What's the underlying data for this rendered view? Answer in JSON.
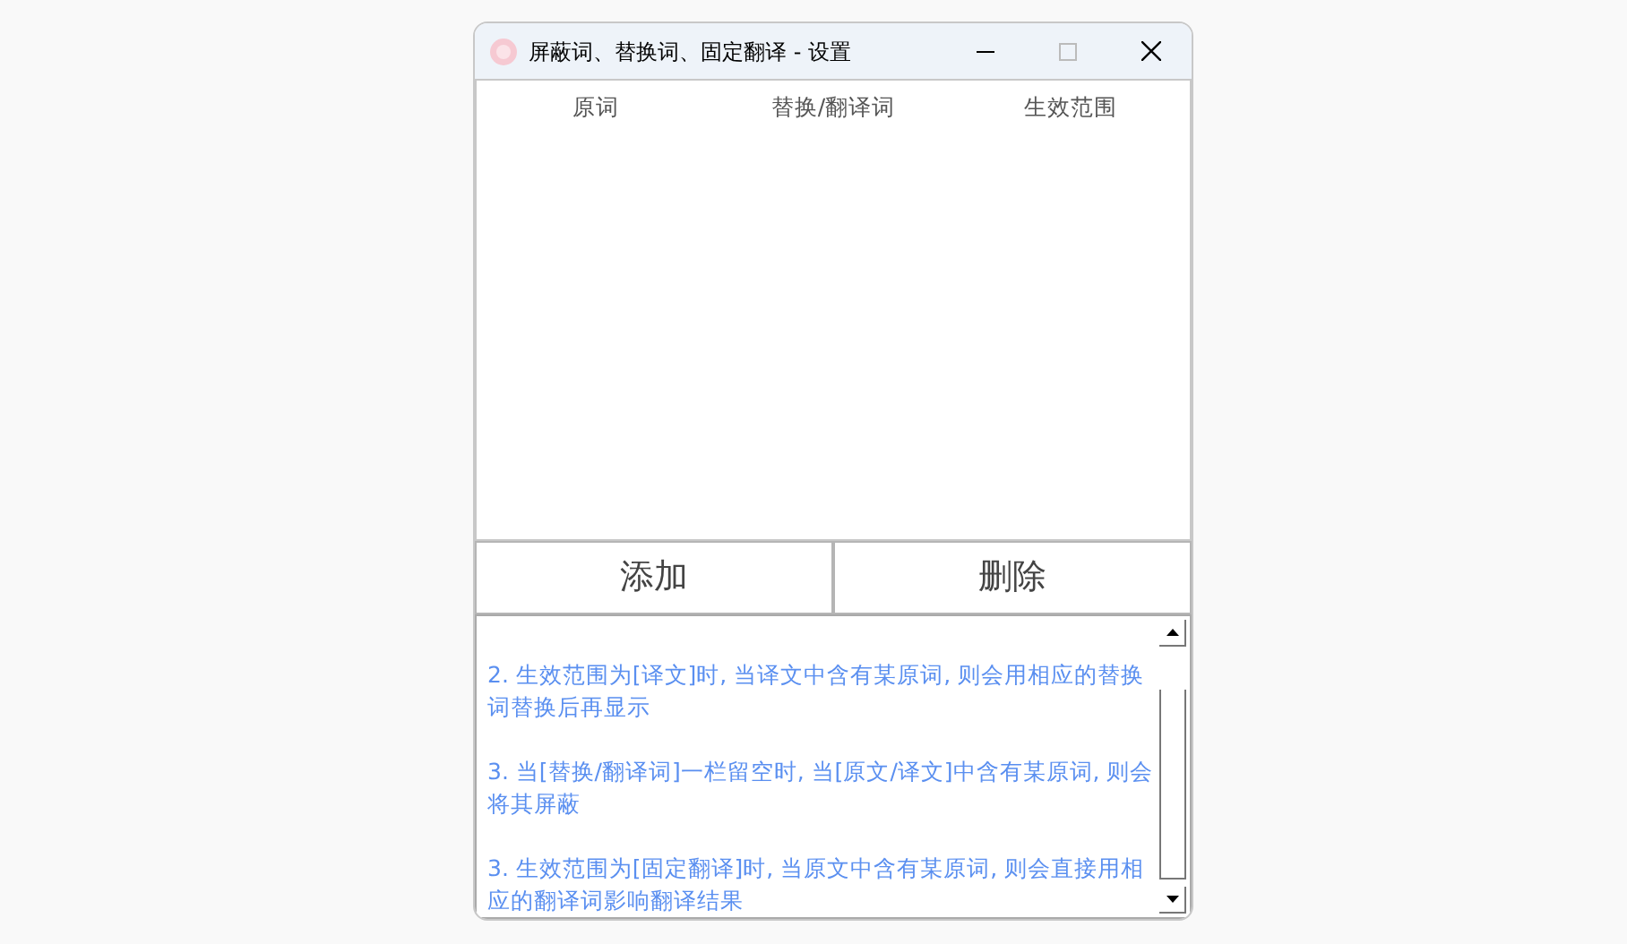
{
  "window": {
    "title": "屏蔽词、替换词、固定翻译 - 设置"
  },
  "table": {
    "columns": [
      "原词",
      "替换/翻译词",
      "生效范围"
    ]
  },
  "buttons": [
    "添加",
    "删除"
  ],
  "notes": [
    "2. 生效范围为[译文]时, 当译文中含有某原词, 则会用相应的替换词替换后再显示",
    "3. 当[替换/翻译词]一栏留空时, 当[原文/译文]中含有某原词, 则会将其屏蔽",
    "3. 生效范围为[固定翻译]时, 当原文中含有某原词, 则会直接用相应的翻译词影响翻译结果"
  ]
}
